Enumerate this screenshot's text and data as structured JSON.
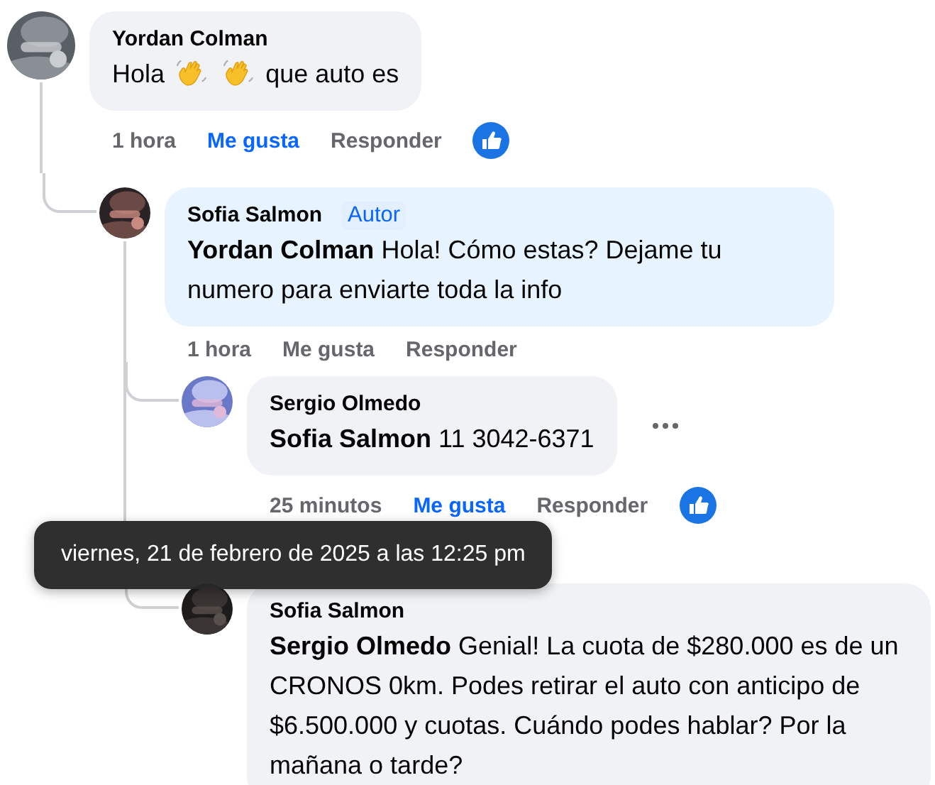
{
  "comments": [
    {
      "author": "Yordan Colman",
      "body": [
        {
          "kind": "text",
          "text": "Hola"
        },
        {
          "kind": "wave"
        },
        {
          "kind": "wave"
        },
        {
          "kind": "text",
          "text": "que auto es"
        }
      ],
      "time": "1 hora",
      "like": "Me gusta",
      "liked": true,
      "reply": "Responder",
      "reaction": true,
      "children": [
        {
          "author": "Sofia Salmon",
          "badge": "Autor",
          "body": [
            {
              "kind": "text",
              "text": "**Yordan Colman** Hola! Cómo estas? Dejame tu numero para enviarte toda la info"
            }
          ],
          "time": "1 hora",
          "like": "Me gusta",
          "liked": false,
          "reply": "Responder",
          "reaction": false,
          "children": [
            {
              "author": "Sergio Olmedo",
              "body": [
                {
                  "kind": "text",
                  "text": "**Sofia Salmon** 11 3042-6371"
                }
              ],
              "more_menu": true,
              "time": "25 minutos",
              "like": "Me gusta",
              "liked": true,
              "reply": "Responder",
              "reaction": true
            },
            {
              "author": "Sofia Salmon",
              "body": [
                {
                  "kind": "text",
                  "text": "**Sergio Olmedo** Genial! La cuota de $280.000 es de un CRONOS 0km. Podes retirar el auto con anticipo de $6.500.000 y cuotas. Cuándo podes hablar? Por la mañana o tarde?"
                }
              ]
            }
          ]
        }
      ]
    }
  ],
  "tooltip": "viernes, 21 de febrero de 2025 a las 12:25 pm"
}
